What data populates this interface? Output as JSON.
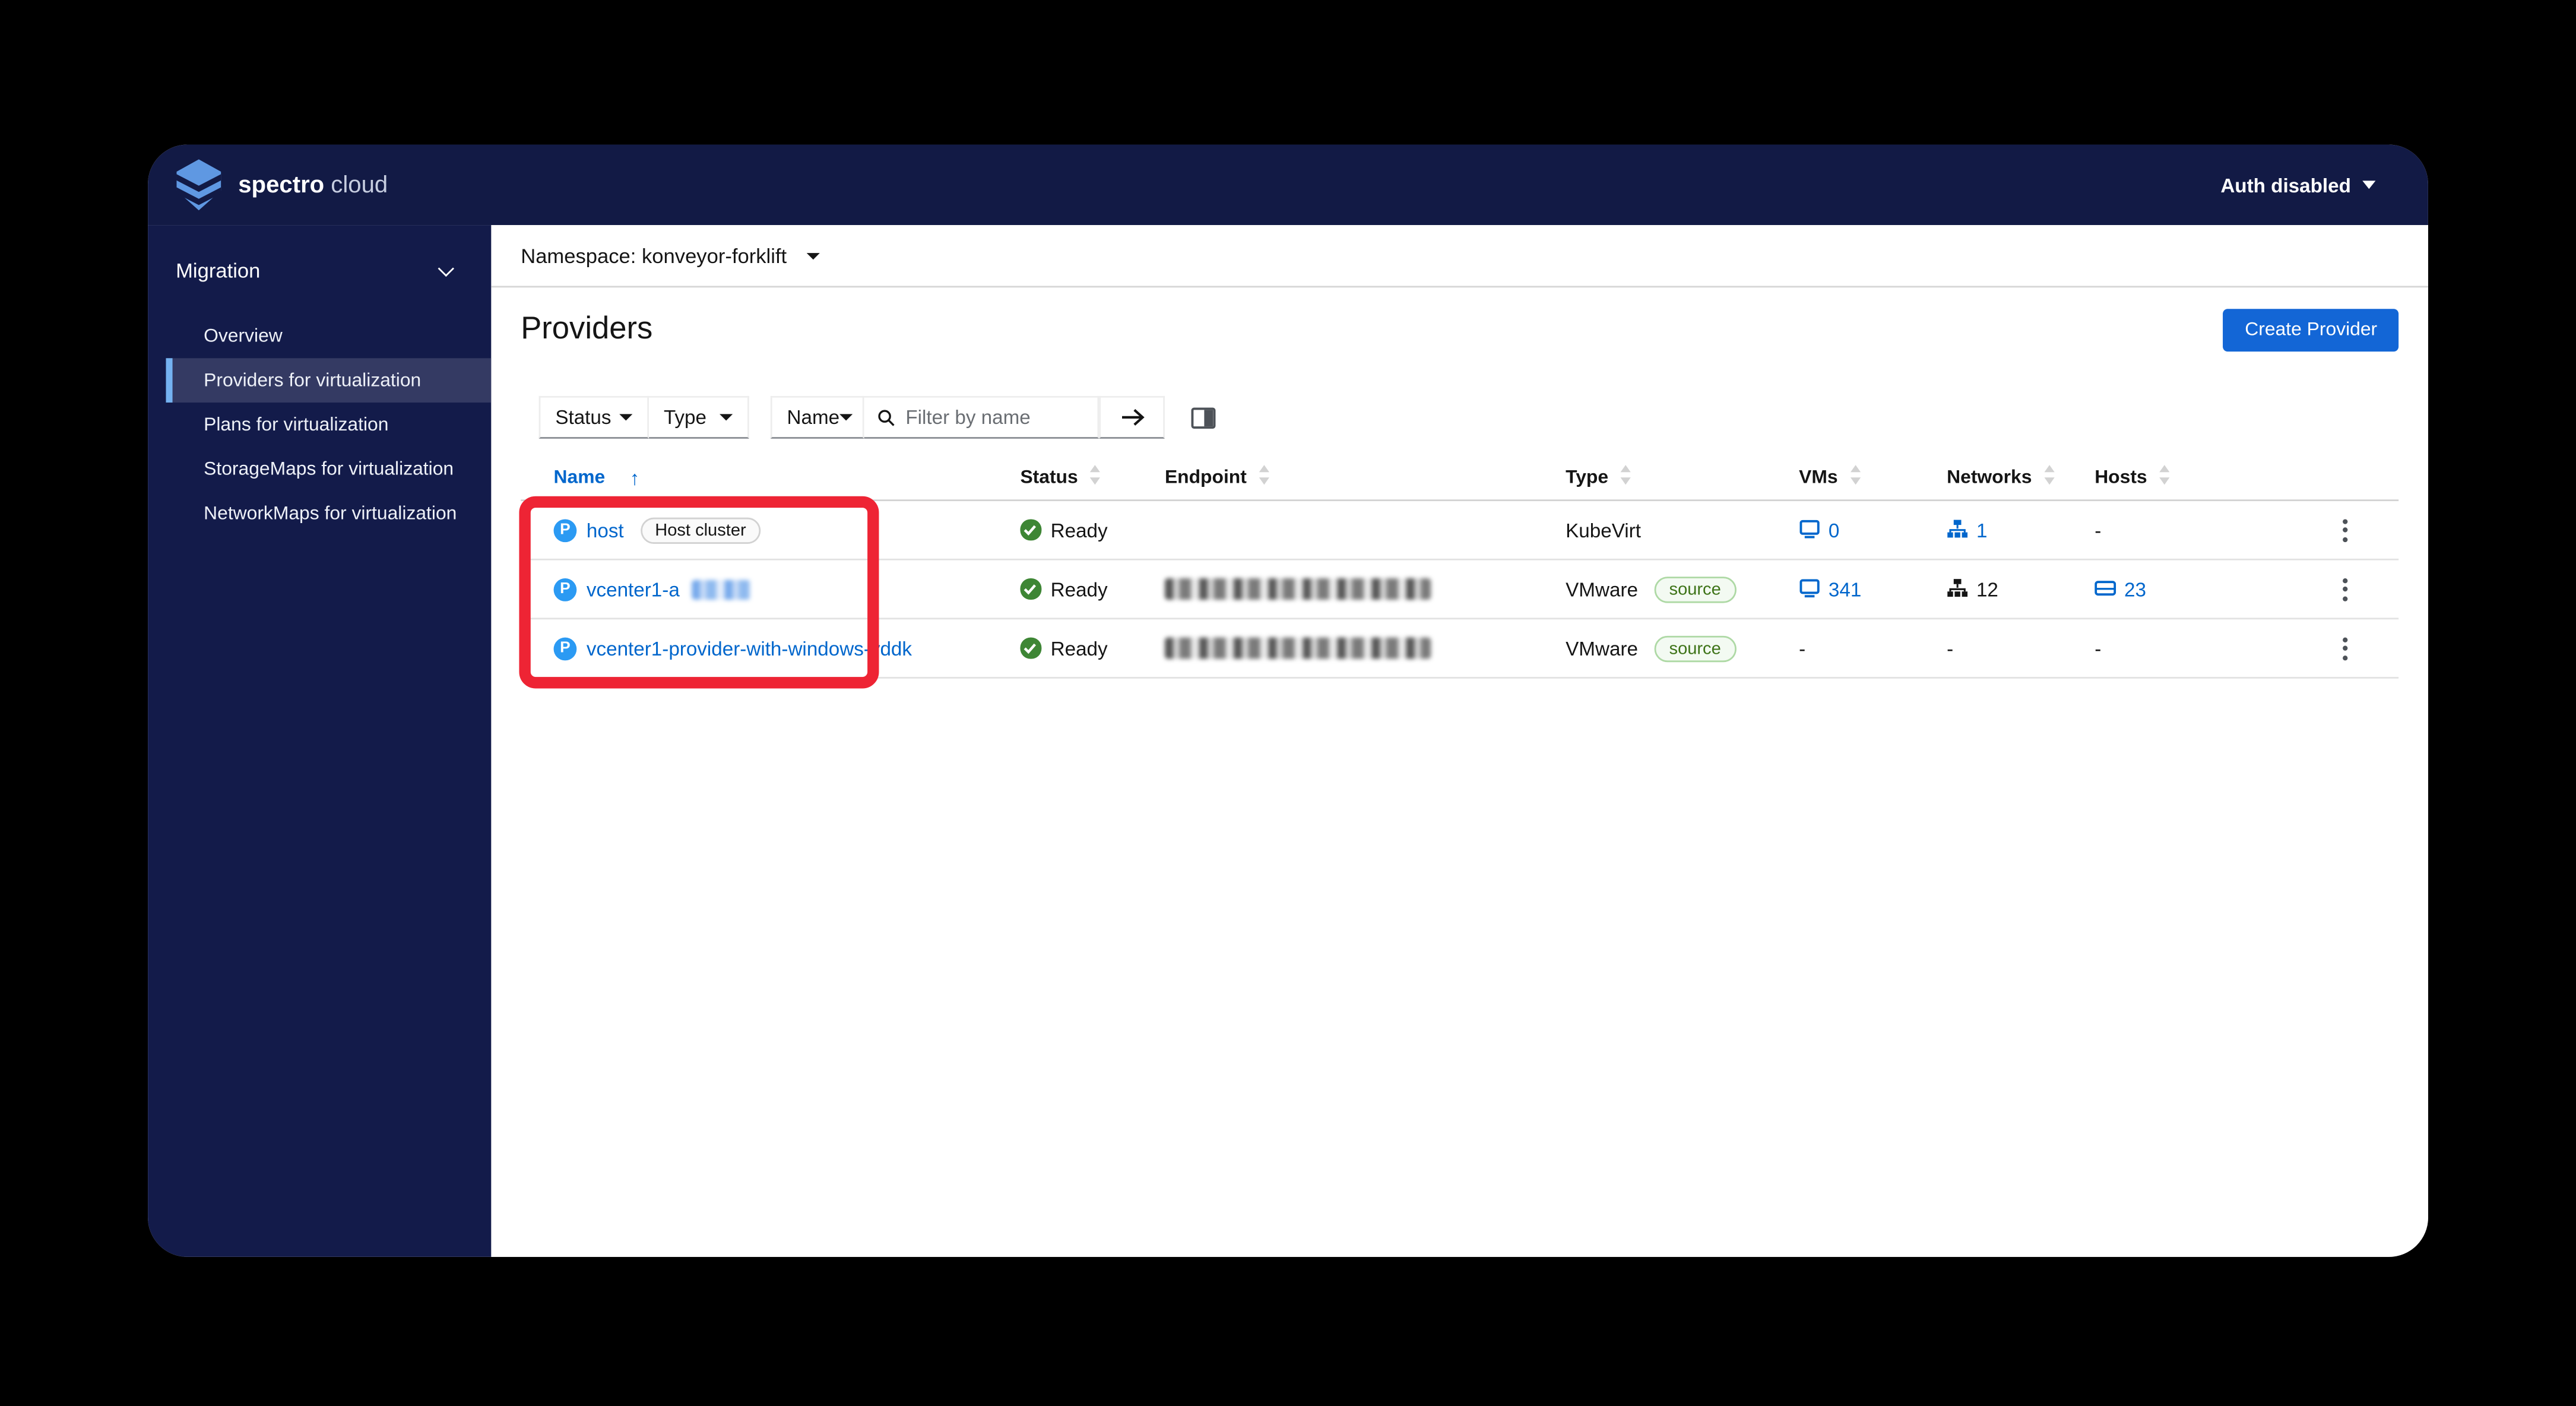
{
  "brand": {
    "bold": "spectro",
    "light": "cloud"
  },
  "topbar": {
    "auth_label": "Auth disabled"
  },
  "sidebar": {
    "group_label": "Migration",
    "items": [
      {
        "label": "Overview",
        "selected": false
      },
      {
        "label": "Providers for virtualization",
        "selected": true
      },
      {
        "label": "Plans for virtualization",
        "selected": false
      },
      {
        "label": "StorageMaps for virtualization",
        "selected": false
      },
      {
        "label": "NetworkMaps for virtualization",
        "selected": false
      }
    ]
  },
  "namespace_bar": {
    "label": "Namespace: konveyor-forklift"
  },
  "page": {
    "title": "Providers",
    "create_button": "Create Provider"
  },
  "filters": {
    "status_label": "Status",
    "type_label": "Type",
    "name_label": "Name",
    "search_placeholder": "Filter by name"
  },
  "table": {
    "provider_icon_letter": "P",
    "columns": [
      {
        "label": "Name",
        "sort": "asc"
      },
      {
        "label": "Status",
        "sort": "none"
      },
      {
        "label": "Endpoint",
        "sort": "none"
      },
      {
        "label": "Type",
        "sort": "none"
      },
      {
        "label": "VMs",
        "sort": "none"
      },
      {
        "label": "Networks",
        "sort": "none"
      },
      {
        "label": "Hosts",
        "sort": "none"
      }
    ],
    "rows": [
      {
        "name": "host",
        "name_redacted": false,
        "name_badge": "Host cluster",
        "status": "Ready",
        "endpoint_redacted": false,
        "type": "KubeVirt",
        "type_badge": null,
        "vms": {
          "value": "0",
          "link": true
        },
        "networks": {
          "value": "1",
          "link": true
        },
        "hosts": {
          "value": "-",
          "link": false
        }
      },
      {
        "name": "vcenter1-a",
        "name_redacted": true,
        "name_badge": null,
        "status": "Ready",
        "endpoint_redacted": true,
        "type": "VMware",
        "type_badge": "source",
        "vms": {
          "value": "341",
          "link": true
        },
        "networks": {
          "value": "12",
          "link": false
        },
        "hosts": {
          "value": "23",
          "link": true
        }
      },
      {
        "name": "vcenter1-provider-with-windows-vddk",
        "name_redacted": false,
        "name_badge": null,
        "status": "Ready",
        "endpoint_redacted": true,
        "type": "VMware",
        "type_badge": "source",
        "vms": {
          "value": "-",
          "link": false
        },
        "networks": {
          "value": "-",
          "link": false
        },
        "hosts": {
          "value": "-",
          "link": false
        }
      }
    ]
  },
  "annotation": {
    "shape": "highlight-box",
    "color": "#ee2434"
  },
  "colors": {
    "brand_navy": "#121a45",
    "sidebar_navy": "#131b4a",
    "selected_item": "#343a63",
    "accent_bar": "#74b2f1",
    "link_blue": "#0066cc",
    "button_blue": "#1366d6",
    "success_green": "#3e8635",
    "annotation_red": "#ee2434"
  }
}
